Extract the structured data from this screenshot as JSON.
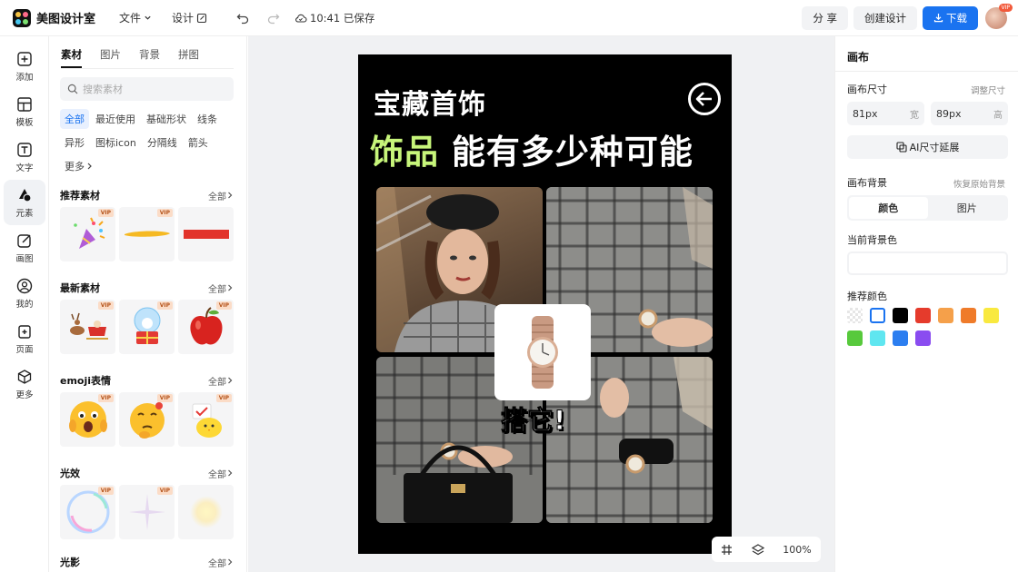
{
  "topbar": {
    "app_name": "美图设计室",
    "menu": [
      "文件",
      "设计"
    ],
    "saved_status": "10:41 已保存",
    "share_label": "分 享",
    "create_label": "创建设计",
    "download_label": "下载",
    "avatar_badge": "VIP"
  },
  "leftnav": {
    "items": [
      "添加",
      "模板",
      "文字",
      "元素",
      "画图",
      "我的",
      "页面",
      "更多"
    ],
    "active": "元素"
  },
  "panel": {
    "tabs": [
      "素材",
      "图片",
      "背景",
      "拼图"
    ],
    "search_placeholder": "搜索素材",
    "chips": [
      "全部",
      "最近使用",
      "基础形状",
      "线条",
      "异形",
      "图标icon",
      "分隔线",
      "箭头",
      "更多"
    ],
    "all_label": "全部",
    "vip_label": "VIP",
    "sections": [
      {
        "title": "推荐素材"
      },
      {
        "title": "最新素材"
      },
      {
        "title": "emoji表情"
      },
      {
        "title": "光效"
      },
      {
        "title": "光影"
      }
    ]
  },
  "canvas": {
    "title_line1": "宝藏首饰",
    "title_line2_highlight": "饰品",
    "title_line2_rest": " 能有多少种可能",
    "cta": "搭它!",
    "zoom": "100%"
  },
  "rpanel": {
    "title": "画布",
    "size_label": "画布尺寸",
    "size_adjust": "调整尺寸",
    "width_value": "81px",
    "width_unit": "宽",
    "height_value": "89px",
    "height_unit": "高",
    "ai_extend": "AI尺寸延展",
    "bg_label": "画布背景",
    "bg_restore": "恢复原始背景",
    "seg_color": "颜色",
    "seg_image": "图片",
    "current_bg_label": "当前背景色",
    "recommend_label": "推荐颜色",
    "swatch_colors": [
      "#ffffff",
      "#ffffff",
      "#000000",
      "#e53b2c",
      "#f5a04a",
      "#ef7b2a",
      "#f9e93f",
      "#57c93c",
      "#5fe6f0",
      "#2c7ef0",
      "#8a4cf0"
    ]
  }
}
